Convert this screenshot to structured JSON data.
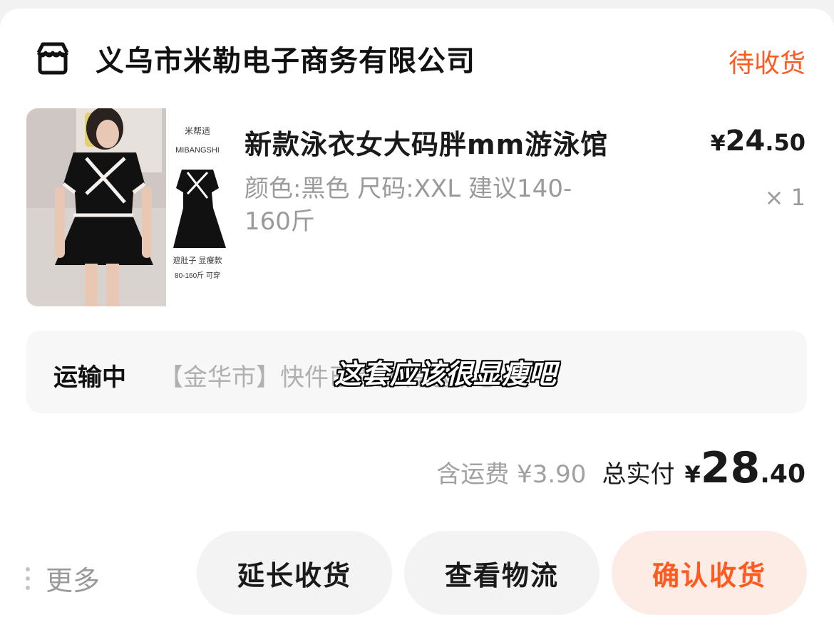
{
  "shop": {
    "name": "义乌市米勒电子商务有限公司",
    "status": "待收货",
    "icon": "store-icon"
  },
  "product": {
    "title": "新款泳衣女大码胖mm游泳馆",
    "price_currency": "¥",
    "price_int": "24",
    "price_dec": ".50",
    "spec": "颜色:黑色 尺码:XXL 建议140-160斤",
    "quantity": "× 1",
    "image": {
      "brand_cn": "米帮适",
      "brand_en": "MIBANGSHI",
      "caption_1": "遮肚子 显瘦款",
      "caption_2": "80-160斤 可穿"
    }
  },
  "shipping": {
    "status": "运输中",
    "info": "【金华市】快件已到达转运中心",
    "subtitle_overlay": "这套应该很显瘦吧"
  },
  "total": {
    "shipping_fee": "含运费 ¥3.90",
    "label": "总实付",
    "currency": "¥",
    "int": "28",
    "dec": ".40"
  },
  "actions": {
    "more_label": "更多",
    "extend_label": "延长收货",
    "logistics_label": "查看物流",
    "confirm_label": "确认收货"
  },
  "colors": {
    "accent": "#ff5a1f",
    "confirm_bg": "#fdece6",
    "button_bg": "#f3f3f3",
    "muted_text": "#9a9a9a"
  }
}
